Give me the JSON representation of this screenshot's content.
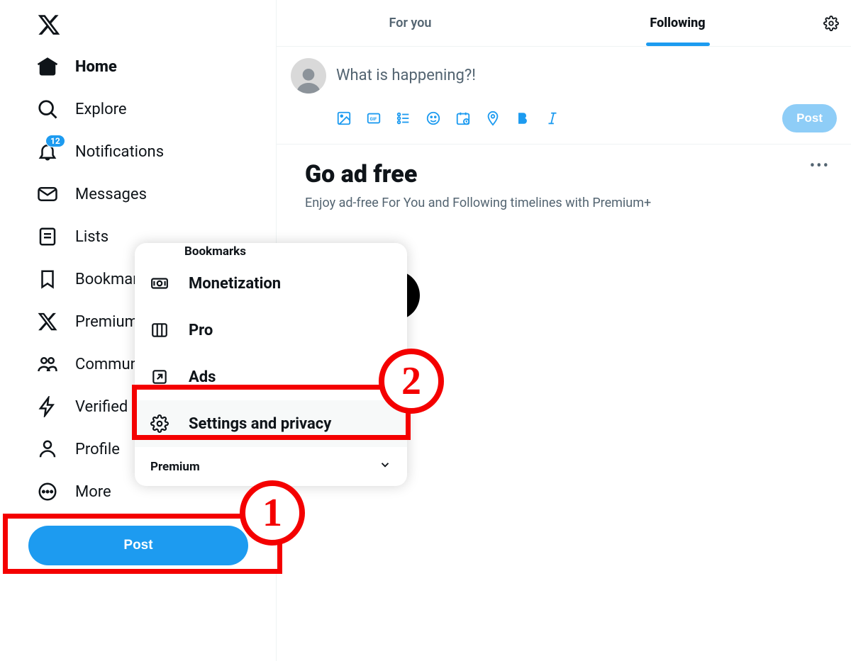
{
  "sidebar": {
    "items": [
      {
        "label": "Home",
        "active": true
      },
      {
        "label": "Explore"
      },
      {
        "label": "Notifications",
        "badge": "12"
      },
      {
        "label": "Messages"
      },
      {
        "label": "Lists"
      },
      {
        "label": "Bookmarks"
      },
      {
        "label": "Premium"
      },
      {
        "label": "Communities"
      },
      {
        "label": "Verified Orgs"
      },
      {
        "label": "Profile"
      },
      {
        "label": "More"
      }
    ],
    "post_label": "Post"
  },
  "tabs": {
    "for_you": "For you",
    "following": "Following"
  },
  "compose": {
    "placeholder": "What is happening?!",
    "post_label": "Post"
  },
  "promo": {
    "title": "Go ad free",
    "subtitle": "Enjoy ad-free For You and Following timelines with Premium+"
  },
  "more_menu": {
    "clip": "Bookmarks",
    "items": [
      {
        "label": "Monetization"
      },
      {
        "label": "Pro"
      },
      {
        "label": "Ads"
      },
      {
        "label": "Settings and privacy"
      }
    ],
    "premium_label": "Premium"
  },
  "annotations": {
    "circle1": "1",
    "circle2": "2"
  }
}
